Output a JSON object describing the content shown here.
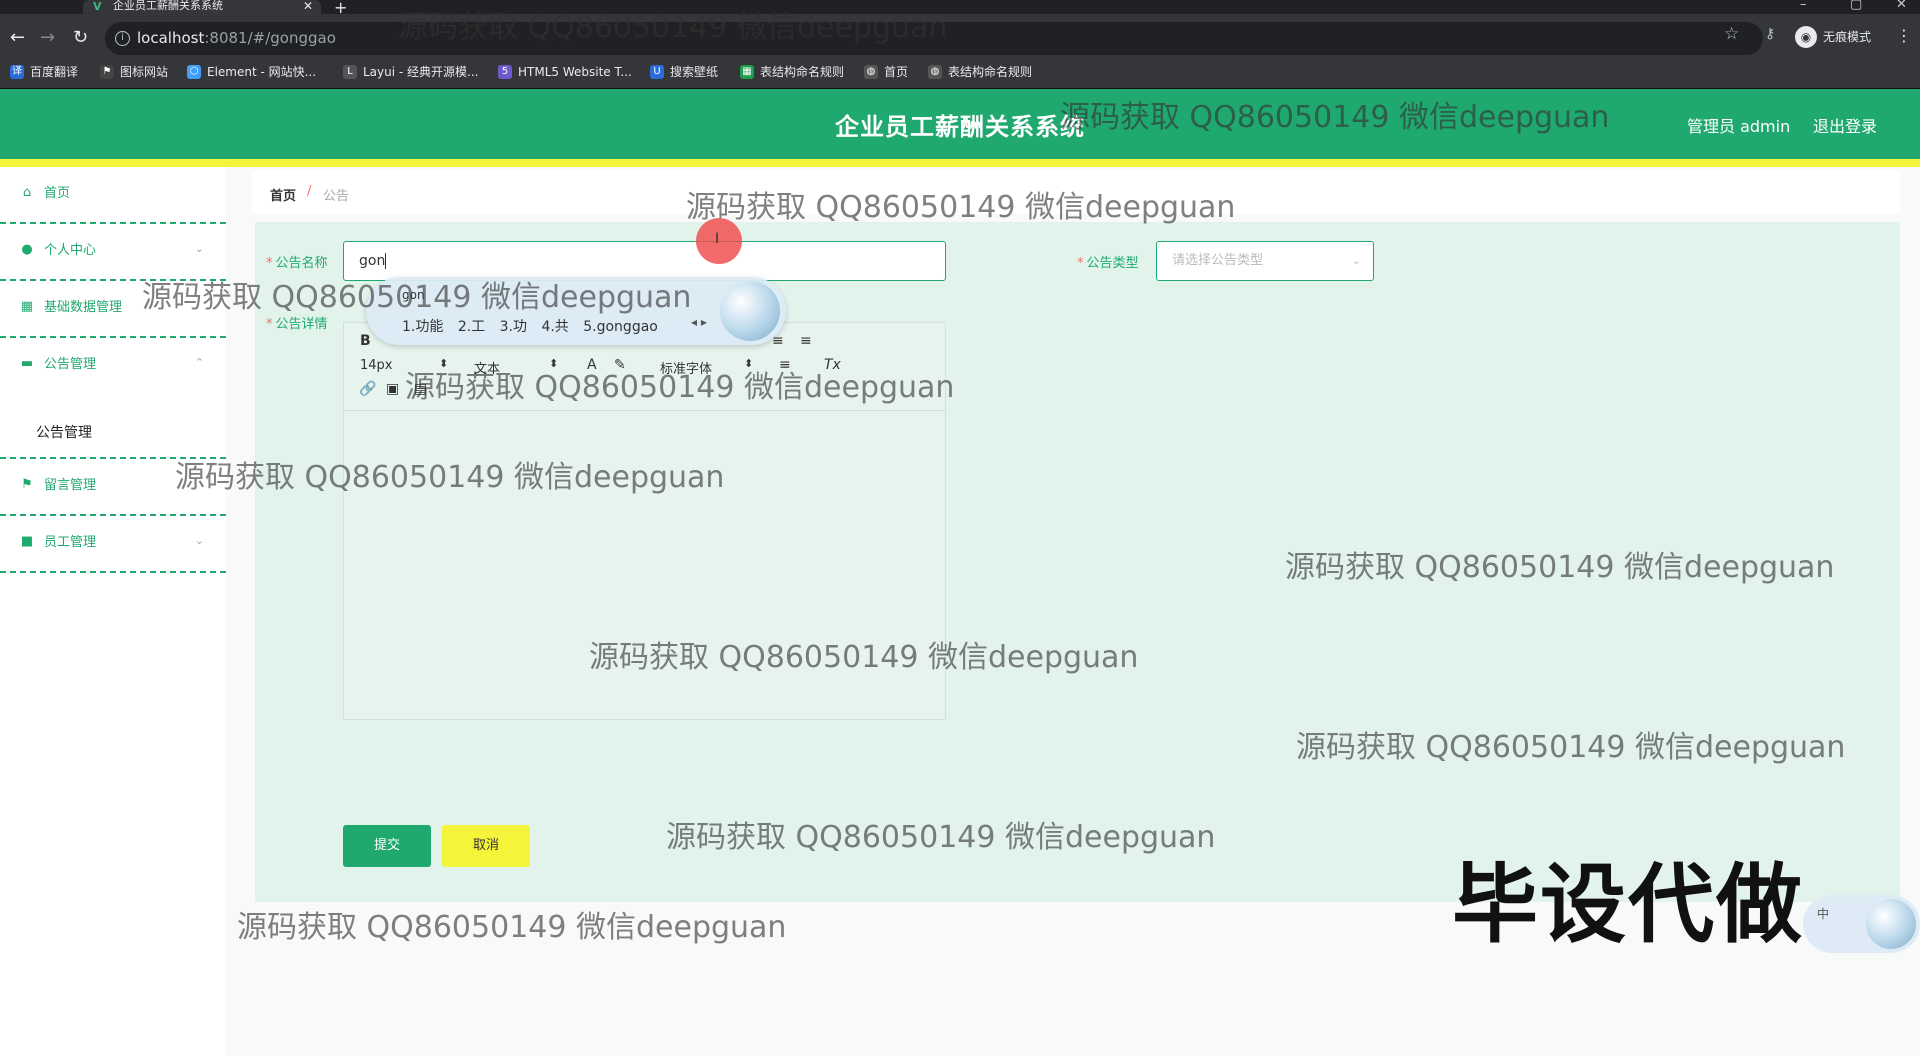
{
  "browser": {
    "tab_title": "企业员工薪酬关系系统",
    "url_host": "localhost",
    "url_path": ":8081/#/gonggao",
    "profile_label": "无痕模式",
    "bookmarks": [
      "百度翻译",
      "图标网站",
      "Element - 网站快...",
      "Layui - 经典开源模...",
      "HTML5 Website T...",
      "搜索壁纸",
      "表结构命名规则",
      "首页",
      "表结构命名规则"
    ]
  },
  "header": {
    "title": "企业员工薪酬关系系统",
    "admin_label": "管理员 admin",
    "logout_label": "退出登录"
  },
  "sidebar": {
    "items": [
      {
        "label": "首页",
        "icon": "home-icon"
      },
      {
        "label": "个人中心",
        "icon": "user-icon"
      },
      {
        "label": "基础数据管理",
        "icon": "grid-icon"
      },
      {
        "label": "公告管理",
        "icon": "notice-icon"
      },
      {
        "label": "留言管理",
        "icon": "flag-icon"
      },
      {
        "label": "员工管理",
        "icon": "briefcase-icon"
      }
    ],
    "sub_item": "公告管理"
  },
  "breadcrumb": {
    "home": "首页",
    "separator": "/",
    "current": "公告"
  },
  "form": {
    "name_label": "公告名称",
    "name_value": "gon",
    "type_label": "公告类型",
    "type_placeholder": "请选择公告类型",
    "detail_label": "公告详情",
    "editor_font_size": "14px",
    "editor_format": "文本",
    "editor_font": "标准字体",
    "submit_label": "提交",
    "cancel_label": "取消"
  },
  "ime": {
    "typed": "gon",
    "candidates": [
      "1.功能",
      "2.工",
      "3.功",
      "4.共",
      "5.gonggao"
    ],
    "mode": "中"
  },
  "overlay": {
    "big_text": "毕设代做",
    "watermark": "源码获取 QQ86050149 微信deepguan"
  }
}
